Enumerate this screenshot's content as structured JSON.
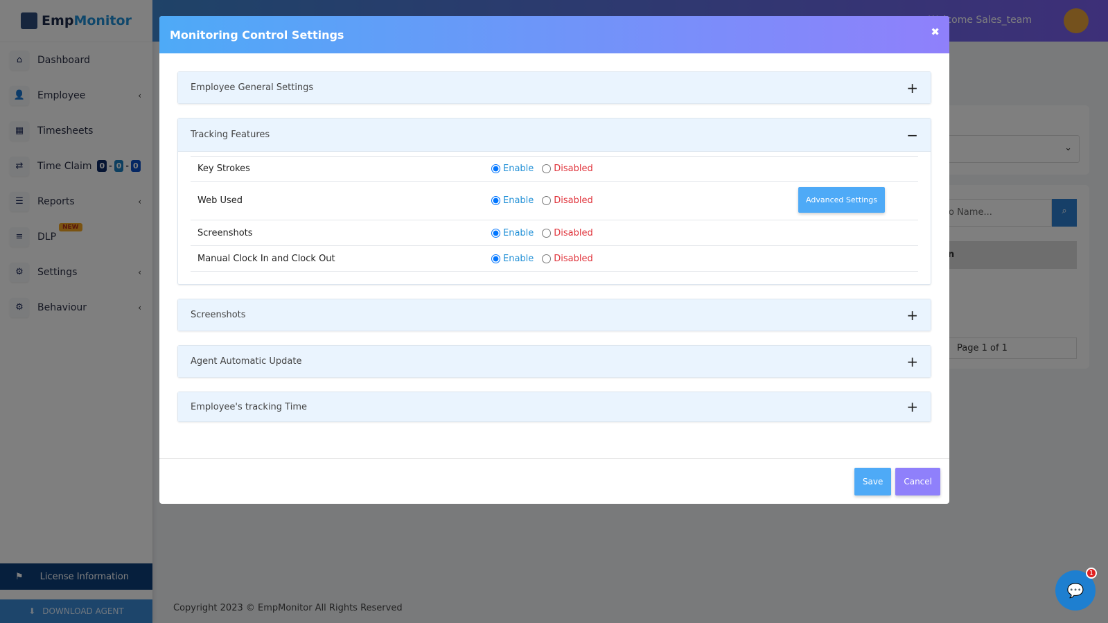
{
  "brand": {
    "part1": "Emp",
    "part2": "Monitor"
  },
  "sidebar": {
    "items": [
      {
        "label": "Dashboard",
        "icon": "home-icon",
        "chev": false
      },
      {
        "label": "Employee",
        "icon": "user-icon",
        "chev": true
      },
      {
        "label": "Timesheets",
        "icon": "calendar-icon",
        "chev": false
      },
      {
        "label": "Time Claim",
        "icon": "arrows-icon",
        "chev": false
      },
      {
        "label": "Reports",
        "icon": "report-icon",
        "chev": true
      },
      {
        "label": "DLP",
        "icon": "sliders-icon",
        "chev": false
      },
      {
        "label": "Settings",
        "icon": "gear-icon",
        "chev": true
      },
      {
        "label": "Behaviour",
        "icon": "user-gear-icon",
        "chev": true
      }
    ],
    "time_claim_counts": [
      "0",
      "0",
      "0"
    ],
    "new_badge": "NEW",
    "license": "License Information",
    "download": "DOWNLOAD AGENT"
  },
  "topbar": {
    "welcome": "Welcome  Sales_team"
  },
  "background": {
    "search_placeholder": "o Name...",
    "column": "n",
    "pagination": "Page  1  of 1"
  },
  "footer": "Copyright 2023 © EmpMonitor All Rights Reserved",
  "modal": {
    "title": "Monitoring Control Settings",
    "close": "✖",
    "panels": {
      "general": "Employee General Settings",
      "tracking": "Tracking Features",
      "screenshots": "Screenshots",
      "update": "Agent Automatic Update",
      "time": "Employee's tracking Time"
    },
    "rows": [
      {
        "label": "Key Strokes",
        "value": "Enable"
      },
      {
        "label": "Web Used",
        "value": "Enable"
      },
      {
        "label": "Screenshots",
        "value": "Enable"
      },
      {
        "label": "Manual Clock In and Clock Out",
        "value": "Enable"
      }
    ],
    "enable": "Enable",
    "disabled": "Disabled",
    "advanced": "Advanced Settings",
    "save": "Save",
    "cancel": "Cancel"
  },
  "chat_badge": "1",
  "colors": {
    "accent": "#4eaaf7",
    "purple": "#8f80fb",
    "enable": "#1f8fd6",
    "disabled": "#e0343c"
  }
}
